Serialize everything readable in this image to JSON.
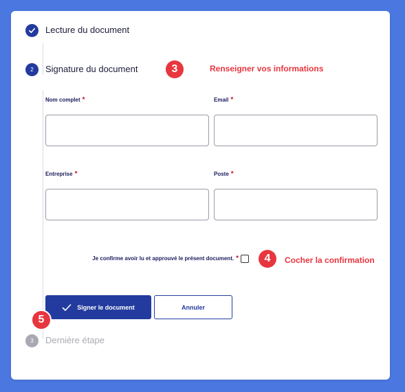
{
  "colors": {
    "page_background": "#4a78e0",
    "primary": "#233b9e",
    "annotation": "#e8363f",
    "required": "#c8102e",
    "step_inactive": "#a9a9b3"
  },
  "steps": [
    {
      "number": "",
      "title": "Lecture du document",
      "status": "completed",
      "icon": "check-icon"
    },
    {
      "number": "2",
      "title": "Signature du document",
      "status": "current"
    },
    {
      "number": "3",
      "title": "Dernière étape",
      "status": "pending"
    }
  ],
  "annotations": {
    "info": {
      "number": "3",
      "text": "Renseigner vos informations"
    },
    "confirm": {
      "number": "4",
      "text": "Cocher la confirmation"
    },
    "sign": {
      "number": "5"
    }
  },
  "form": {
    "required_marker": "*",
    "fields": [
      {
        "label": "Nom complet",
        "value": "",
        "placeholder": ""
      },
      {
        "label": "Email",
        "value": "",
        "placeholder": ""
      },
      {
        "label": "Entreprise",
        "value": "",
        "placeholder": ""
      },
      {
        "label": "Poste",
        "value": "",
        "placeholder": ""
      }
    ],
    "confirm_label": "Je confirme avoir lu et approuvé le présent document.",
    "confirm_checked": false
  },
  "buttons": {
    "sign": {
      "label": "Signer le document",
      "icon": "check-icon"
    },
    "cancel": {
      "label": "Annuler"
    }
  }
}
